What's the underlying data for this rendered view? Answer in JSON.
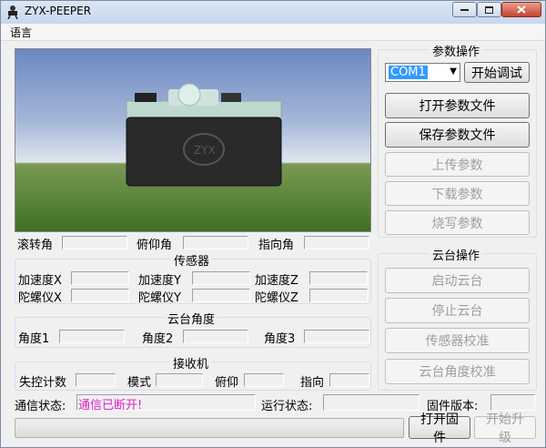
{
  "window": {
    "title": "ZYX-PEEPER"
  },
  "menu": {
    "language": "语言"
  },
  "attitude": {
    "roll": "滚转角",
    "pitch": "俯仰角",
    "yaw": "指向角"
  },
  "sensor": {
    "title": "传感器",
    "accel_x": "加速度X",
    "accel_y": "加速度Y",
    "accel_z": "加速度Z",
    "gyro_x": "陀螺仪X",
    "gyro_y": "陀螺仪Y",
    "gyro_z": "陀螺仪Z"
  },
  "gimbal_angle": {
    "title": "云台角度",
    "angle1": "角度1",
    "angle2": "角度2",
    "angle3": "角度3"
  },
  "receiver": {
    "title": "接收机",
    "failsafe": "失控计数",
    "mode": "模式",
    "pitch": "俯仰",
    "direction": "指向"
  },
  "params": {
    "title": "参数操作",
    "port": "COM1",
    "start_debug": "开始调试",
    "open_file": "打开参数文件",
    "save_file": "保存参数文件",
    "upload": "上传参数",
    "download": "下载参数",
    "burn": "烧写参数"
  },
  "gimbal_ops": {
    "title": "云台操作",
    "start": "启动云台",
    "stop": "停止云台",
    "calib_sensor": "传感器校准",
    "calib_angle": "云台角度校准"
  },
  "status": {
    "comm_label": "通信状态:",
    "comm_value": "通信已断开!",
    "run_label": "运行状态:",
    "fw_label": "固件版本:"
  },
  "firmware": {
    "open": "打开固件",
    "upgrade": "开始升级",
    "progress": 0
  },
  "colors": {
    "status_text": "#e020c8",
    "progress_fill": "#06b025",
    "selection": "#3399ff"
  }
}
